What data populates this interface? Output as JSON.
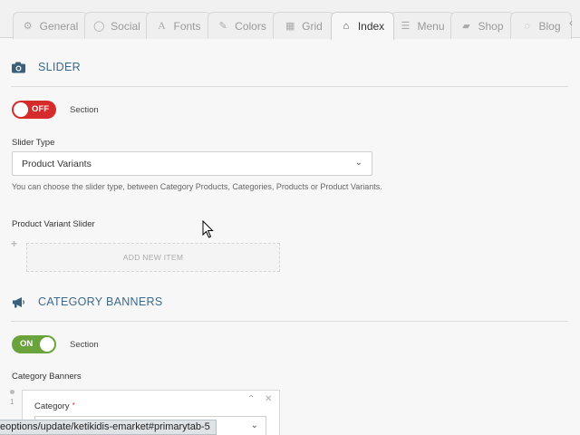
{
  "tabs": [
    {
      "label": "General",
      "icon": "gear-icon",
      "glyph": "⚙"
    },
    {
      "label": "Social",
      "icon": "speech-bubble-icon",
      "glyph": "💬"
    },
    {
      "label": "Fonts",
      "icon": "font-icon",
      "glyph": "A"
    },
    {
      "label": "Colors",
      "icon": "brush-icon",
      "glyph": "🖌"
    },
    {
      "label": "Grid",
      "icon": "grid-icon",
      "glyph": "▦"
    },
    {
      "label": "Index",
      "icon": "home-icon",
      "glyph": "⌂"
    },
    {
      "label": "Menu",
      "icon": "list-icon",
      "glyph": "☰"
    },
    {
      "label": "Shop",
      "icon": "shopping-bag-icon",
      "glyph": "👜"
    },
    {
      "label": "Blog",
      "icon": "comment-icon",
      "glyph": "💬"
    }
  ],
  "active_tab": "Index",
  "slider": {
    "title": "SLIDER",
    "icon": "camera-icon",
    "toggle_state": "OFF",
    "toggle_caption": "Section",
    "type_label": "Slider Type",
    "type_value": "Product Variants",
    "help": "You can choose the slider type, between Category Products, Categories, Products or Product Variants.",
    "variant_label": "Product Variant Slider",
    "add_item": "ADD NEW ITEM"
  },
  "banners": {
    "title": "CATEGORY BANNERS",
    "icon": "megaphone-icon",
    "toggle_state": "ON",
    "toggle_caption": "Section",
    "list_label": "Category Banners",
    "row_number": "1",
    "category_label": "Category",
    "required_mark": "*"
  },
  "status_url": "eoptions/update/ketikidis-emarket#primarytab-5",
  "colors": {
    "accent": "#3b6a8c",
    "off": "#d62b2b",
    "on": "#6aa33c"
  }
}
